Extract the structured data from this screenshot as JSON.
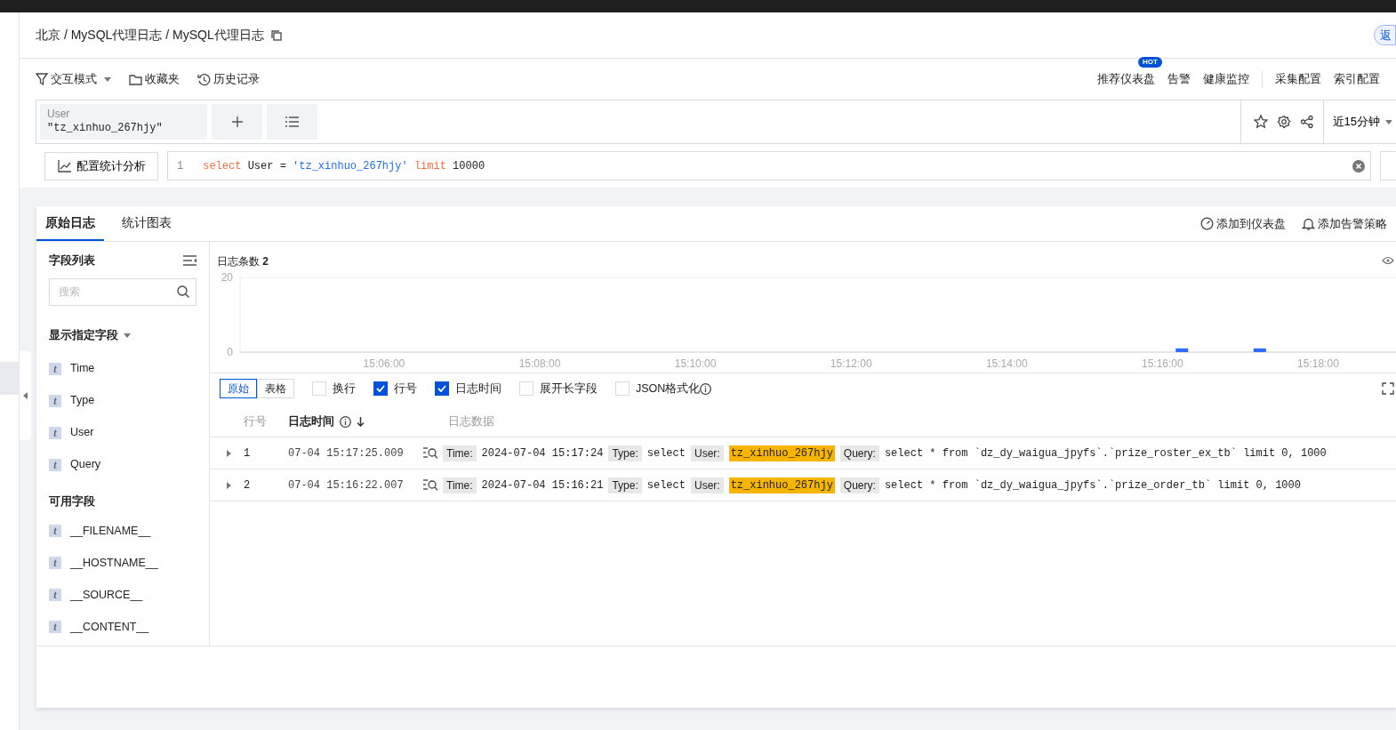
{
  "breadcrumb": "北京 / MySQL代理日志 / MySQL代理日志",
  "back_button": "返",
  "toolbar": {
    "left": [
      {
        "kind": "filter",
        "label": "交互模式"
      },
      {
        "kind": "folder",
        "label": "收藏夹"
      },
      {
        "kind": "history",
        "label": "历史记录"
      }
    ],
    "right": [
      {
        "label": "推荐仪表盘",
        "badge": "HOT",
        "divider_before": false
      },
      {
        "label": "告警",
        "divider_before": false
      },
      {
        "label": "健康监控",
        "divider_before": false
      },
      {
        "label": "采集配置",
        "divider_before": true
      },
      {
        "label": "索引配置",
        "divider_before": false
      }
    ]
  },
  "filter": {
    "field": "User",
    "value": "\"tz_xinhuo_267hjy\""
  },
  "time_range": "近15分钟",
  "analysis_button": "配置统计分析",
  "query": {
    "line_number": "1",
    "tokens": [
      {
        "kind": "keyword",
        "text": "select"
      },
      {
        "kind": "plain",
        "text": "User ="
      },
      {
        "kind": "string",
        "text": "'tz_xinhuo_267hjy'"
      },
      {
        "kind": "keyword",
        "text": "limit"
      },
      {
        "kind": "plain",
        "text": "10000"
      }
    ]
  },
  "tabs": [
    {
      "label": "原始日志",
      "selected": true
    },
    {
      "label": "统计图表",
      "selected": false
    }
  ],
  "actions": [
    {
      "kind": "dashboard",
      "label": "添加到仪表盘"
    },
    {
      "kind": "alarm",
      "label": "添加告警策略"
    }
  ],
  "field_panel": {
    "title": "字段列表",
    "search": {
      "placeholder": "搜索"
    },
    "shown_title": "显示指定字段",
    "shown_fields": [
      {
        "type": "t",
        "name": "Time"
      },
      {
        "type": "t",
        "name": "Type"
      },
      {
        "type": "t",
        "name": "User"
      },
      {
        "type": "t",
        "name": "Query"
      }
    ],
    "available_title": "可用字段",
    "available_fields": [
      {
        "type": "t",
        "name": "__FILENAME__"
      },
      {
        "type": "t",
        "name": "__HOSTNAME__"
      },
      {
        "type": "t",
        "name": "__SOURCE__"
      },
      {
        "type": "t",
        "name": "__CONTENT__"
      }
    ]
  },
  "chart": {
    "title": "日志条数 **2**",
    "chart_data": {
      "type": "bar",
      "categories": [
        null,
        null,
        null,
        null,
        "15:06:00",
        null,
        null,
        null,
        "15:08:00",
        null,
        null,
        null,
        "15:10:00",
        null,
        null,
        null,
        "15:12:00",
        null,
        null,
        null,
        "15:14:00",
        null,
        null,
        null,
        "15:16:00",
        null,
        null,
        null,
        "15:18:00",
        null
      ],
      "values": [
        null,
        null,
        null,
        null,
        null,
        null,
        null,
        null,
        null,
        null,
        null,
        null,
        null,
        null,
        null,
        null,
        null,
        null,
        null,
        null,
        null,
        null,
        null,
        null,
        1,
        null,
        1,
        null,
        null,
        null
      ],
      "ylim": [
        0,
        20
      ],
      "yticks": [
        0,
        20
      ]
    }
  },
  "view_modes": [
    {
      "label": "原始",
      "selected": true
    },
    {
      "label": "表格",
      "selected": false
    }
  ],
  "options": [
    {
      "label": "换行",
      "checked": false,
      "info": false
    },
    {
      "label": "行号",
      "checked": true,
      "info": false
    },
    {
      "label": "日志时间",
      "checked": true,
      "info": false
    },
    {
      "label": "展开长字段",
      "checked": false,
      "info": false
    },
    {
      "label": "JSON格式化",
      "checked": false,
      "info": true
    }
  ],
  "columns": [
    {
      "label": "行号",
      "sorted": false
    },
    {
      "label": "日志时间",
      "sorted": true
    },
    {
      "label": "日志数据",
      "sorted": false
    }
  ],
  "rows": [
    {
      "number": "1",
      "time": "07-04 15:17:25.009",
      "fields": [
        {
          "key": "Time:",
          "value": "2024-07-04 15:17:24",
          "highlighted": false
        },
        {
          "key": "Type:",
          "value": "select",
          "highlighted": false
        },
        {
          "key": "User:",
          "value": "tz_xinhuo_267hjy",
          "highlighted": true
        },
        {
          "key": "Query:",
          "value": "select * from `dz_dy_waigua_jpyfs`.`prize_roster_ex_tb` limit 0, 1000",
          "highlighted": false
        }
      ]
    },
    {
      "number": "2",
      "time": "07-04 15:16:22.007",
      "fields": [
        {
          "key": "Time:",
          "value": "2024-07-04 15:16:21",
          "highlighted": false
        },
        {
          "key": "Type:",
          "value": "select",
          "highlighted": false
        },
        {
          "key": "User:",
          "value": "tz_xinhuo_267hjy",
          "highlighted": true
        },
        {
          "key": "Query:",
          "value": "select * from `dz_dy_waigua_jpyfs`.`prize_order_tb` limit 0, 1000",
          "highlighted": false
        }
      ]
    }
  ]
}
